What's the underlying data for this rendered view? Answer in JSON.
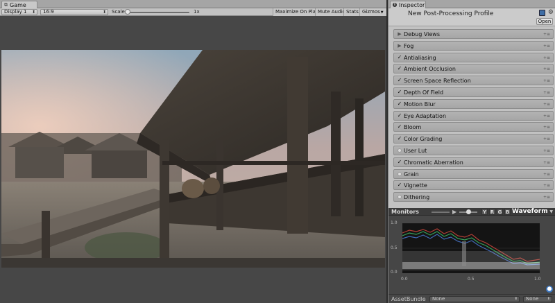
{
  "game": {
    "tab_label": "Game",
    "display_value": "Display 1",
    "aspect_value": "16:9",
    "scale_label": "Scale",
    "scale_value": "1x",
    "buttons": {
      "maximize": "Maximize On Play",
      "mute": "Mute Audio",
      "stats": "Stats",
      "gizmos": "Gizmos"
    }
  },
  "inspector": {
    "tab_label": "Inspector",
    "title": "New Post-Processing Profile",
    "open_label": "Open",
    "effects": [
      {
        "name": "Debug Views",
        "state": "collapsed"
      },
      {
        "name": "Fog",
        "state": "collapsed"
      },
      {
        "name": "Antialiasing",
        "state": "checked"
      },
      {
        "name": "Ambient Occlusion",
        "state": "checked"
      },
      {
        "name": "Screen Space Reflection",
        "state": "checked"
      },
      {
        "name": "Depth Of Field",
        "state": "checked"
      },
      {
        "name": "Motion Blur",
        "state": "checked"
      },
      {
        "name": "Eye Adaptation",
        "state": "checked"
      },
      {
        "name": "Bloom",
        "state": "checked"
      },
      {
        "name": "Color Grading",
        "state": "checked"
      },
      {
        "name": "User Lut",
        "state": "unchecked"
      },
      {
        "name": "Chromatic Aberration",
        "state": "checked"
      },
      {
        "name": "Grain",
        "state": "unchecked"
      },
      {
        "name": "Vignette",
        "state": "checked"
      },
      {
        "name": "Dithering",
        "state": "unchecked"
      }
    ],
    "menu_glyph": "+≡",
    "check_glyph": "✓",
    "collapsed_glyph": "▶"
  },
  "monitors": {
    "title": "Monitors",
    "channels": [
      "Y",
      "R",
      "G",
      "B"
    ],
    "mode": "Waveform",
    "y_ticks": [
      "1.0",
      "0.5",
      "0.0"
    ],
    "x_ticks": [
      "0.0",
      "0.5",
      "1.0"
    ]
  },
  "asset_bundle": {
    "label": "AssetBundle",
    "bundle_value": "None",
    "variant_value": "None"
  }
}
